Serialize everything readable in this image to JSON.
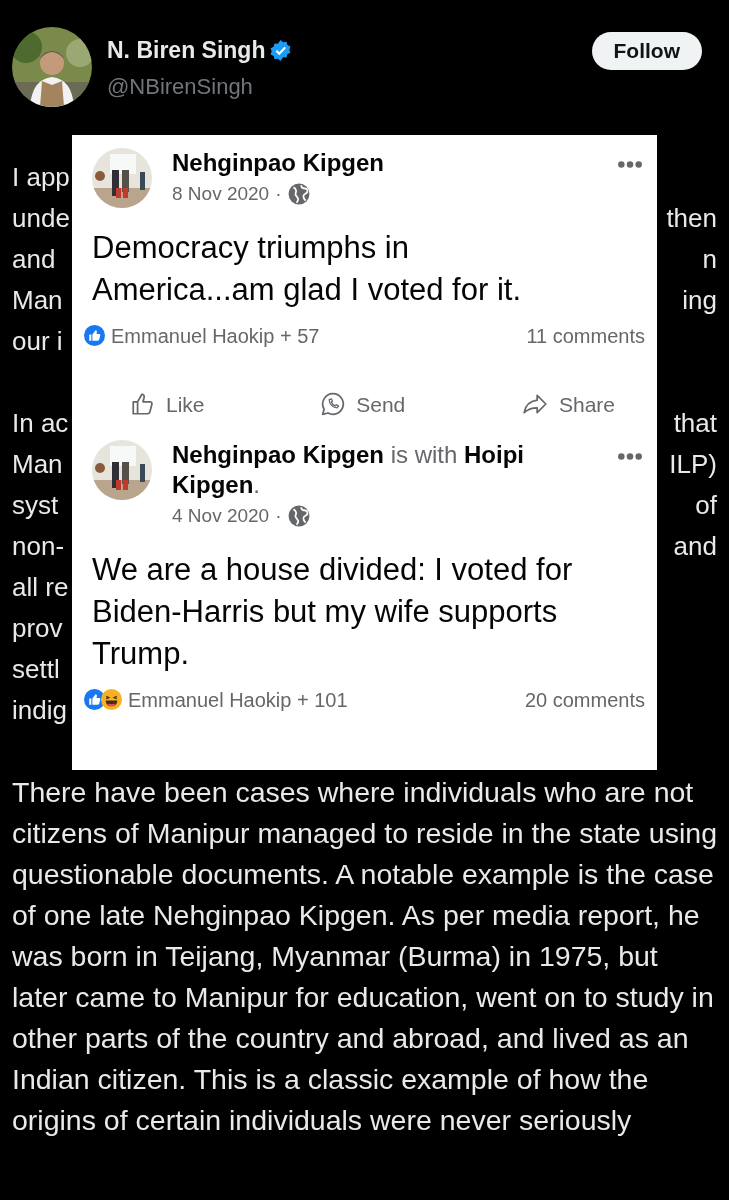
{
  "tweet": {
    "author": {
      "name": "N. Biren Singh",
      "handle": "@NBirenSingh",
      "verified": true
    },
    "follow_button": "Follow",
    "obscured_paragraphs": [
      [
        {
          "left": "I app"
        },
        {
          "left": "unde",
          "right": "then"
        },
        {
          "left": "and",
          "right": "n"
        },
        {
          "left": "Man",
          "right": "ing"
        },
        {
          "left": "our i"
        }
      ],
      [
        {
          "left": "In ac",
          "right": "that"
        },
        {
          "left": "Man",
          "right": "ILP)"
        },
        {
          "left": "syst",
          "right": "of"
        },
        {
          "left": "non-",
          "right": "and"
        },
        {
          "left": "all re"
        },
        {
          "left": "prov"
        },
        {
          "left": "settl"
        },
        {
          "left": "indig"
        }
      ]
    ],
    "paragraph": "There have been cases where individuals who are not citizens of Manipur managed to reside in the state using questionable documents. A notable example is the case of one late Nehginpao Kipgen. As per media report, he was born in Teijang, Myanmar (Burma) in 1975, but later came to Manipur for education, went on to study in other parts of the country and abroad, and lived as an Indian citizen. This is a classic example of how the origins of certain individuals were never seriously"
  },
  "facebook_posts": [
    {
      "author_line": "**Nehginpao Kipgen**",
      "date": "8 Nov 2020",
      "separator": "·",
      "body": "Democracy triumphs in America...am glad I voted for it.",
      "reactions": [
        {
          "kind": "like"
        }
      ],
      "reactor": "Emmanuel Haokip + 57",
      "comments": "11 comments",
      "actions": [
        {
          "kind": "like",
          "label": "Like"
        },
        {
          "kind": "send",
          "label": "Send"
        },
        {
          "kind": "share",
          "label": "Share"
        }
      ]
    },
    {
      "author_line": "**Nehginpao Kipgen** is with **Hoipi Kipgen**.",
      "date": "4 Nov 2020",
      "separator": "·",
      "body": "We are a house divided: I voted for Biden-Harris but my wife supports Trump.",
      "reactions": [
        {
          "kind": "like"
        },
        {
          "kind": "haha"
        }
      ],
      "reactor": "Emmanuel Haokip + 101",
      "comments": "20 comments"
    }
  ]
}
